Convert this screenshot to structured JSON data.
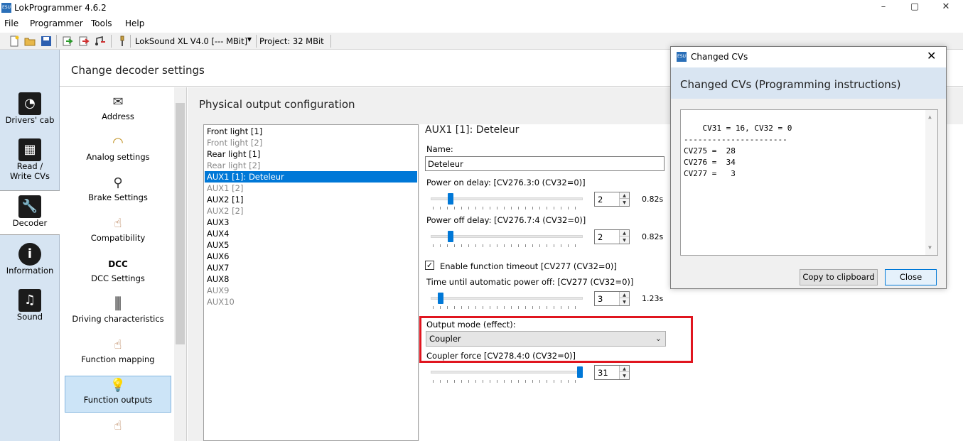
{
  "app": {
    "title": "LokProgrammer 4.6.2",
    "icon_text": "ESU",
    "window_controls": [
      "–",
      "▢",
      "✕"
    ]
  },
  "menu": [
    "File",
    "Programmer",
    "Tools",
    "Help"
  ],
  "toolbar": {
    "decoder": "LokSound XL V4.0 [--- MBit]",
    "project": "Project:  32 MBit"
  },
  "leftnav": [
    {
      "label": "Drivers' cab",
      "icon": "speedometer-icon",
      "glyph": "◔"
    },
    {
      "label": "Read / Write CVs",
      "icon": "binary-icon",
      "glyph": "▦"
    },
    {
      "label": "Decoder",
      "icon": "wrench-icon",
      "glyph": "🔧",
      "selected": true
    },
    {
      "label": "Information",
      "icon": "info-icon",
      "glyph": "i"
    },
    {
      "label": "Sound",
      "icon": "music-icon",
      "glyph": "♫"
    }
  ],
  "main": {
    "title": "Change decoder settings"
  },
  "categories": [
    {
      "label": "Address",
      "icon": "envelope-icon",
      "glyph": "✉"
    },
    {
      "label": "Analog settings",
      "icon": "gauge-icon",
      "glyph": "◠"
    },
    {
      "label": "Brake Settings",
      "icon": "brake-icon",
      "glyph": "⚲"
    },
    {
      "label": "Compatibility",
      "icon": "hand-switch-icon",
      "glyph": "☝"
    },
    {
      "label": "DCC Settings",
      "icon": "dcc-icon",
      "glyph": "DCC"
    },
    {
      "label": "Driving characteristics",
      "icon": "sliders-icon",
      "glyph": "⫼"
    },
    {
      "label": "Function mapping",
      "icon": "hand-switch-icon",
      "glyph": "☝"
    },
    {
      "label": "Function outputs",
      "icon": "bulb-icon",
      "glyph": "💡",
      "selected": true
    },
    {
      "label": "",
      "icon": "hand-switch-icon",
      "glyph": "☝"
    }
  ],
  "physical": {
    "title": "Physical output configuration",
    "outputs": [
      {
        "label": "Front light [1]",
        "dim": false
      },
      {
        "label": "Front light [2]",
        "dim": true
      },
      {
        "label": "Rear light [1]",
        "dim": false
      },
      {
        "label": "Rear light [2]",
        "dim": true
      },
      {
        "label": "AUX1 [1]: Deteleur",
        "dim": false,
        "selected": true
      },
      {
        "label": "AUX1 [2]",
        "dim": true
      },
      {
        "label": "AUX2 [1]",
        "dim": false
      },
      {
        "label": "AUX2 [2]",
        "dim": true
      },
      {
        "label": "AUX3",
        "dim": false
      },
      {
        "label": "AUX4",
        "dim": false
      },
      {
        "label": "AUX5",
        "dim": false
      },
      {
        "label": "AUX6",
        "dim": false
      },
      {
        "label": "AUX7",
        "dim": false
      },
      {
        "label": "AUX8",
        "dim": false
      },
      {
        "label": "AUX9",
        "dim": true
      },
      {
        "label": "AUX10",
        "dim": true
      }
    ]
  },
  "detail": {
    "title": "AUX1 [1]: Deteleur",
    "name_label": "Name:",
    "name_value": "Deteleur",
    "power_on_label": "Power on delay: [CV276.3:0 (CV32=0)]",
    "power_on_value": "2",
    "power_on_unit": "0.82s",
    "power_on_level": 0.1,
    "power_off_label": "Power off delay: [CV276.7:4 (CV32=0)]",
    "power_off_value": "2",
    "power_off_unit": "0.82s",
    "power_off_level": 0.1,
    "timeout_check_label": "Enable function timeout [CV277 (CV32=0)]",
    "timeout_checked": true,
    "time_label": "Time until automatic power off: [CV277 (CV32=0)]",
    "time_value": "3",
    "time_unit": "1.23s",
    "time_level": 0.03,
    "mode_label": "Output mode (effect):",
    "mode_value": "Coupler",
    "force_label": "Coupler force [CV278.4:0 (CV32=0)]",
    "force_value": "31",
    "force_level": 1.0,
    "highlight_color": "#e0151f"
  },
  "dialog": {
    "title": "Changed CVs",
    "heading": "Changed CVs (Programming instructions)",
    "text": "CV31 = 16, CV32 = 0\n----------------------\nCV275 =  28\nCV276 =  34\nCV277 =   3",
    "copy_button": "Copy to clipboard",
    "close_button": "Close"
  }
}
